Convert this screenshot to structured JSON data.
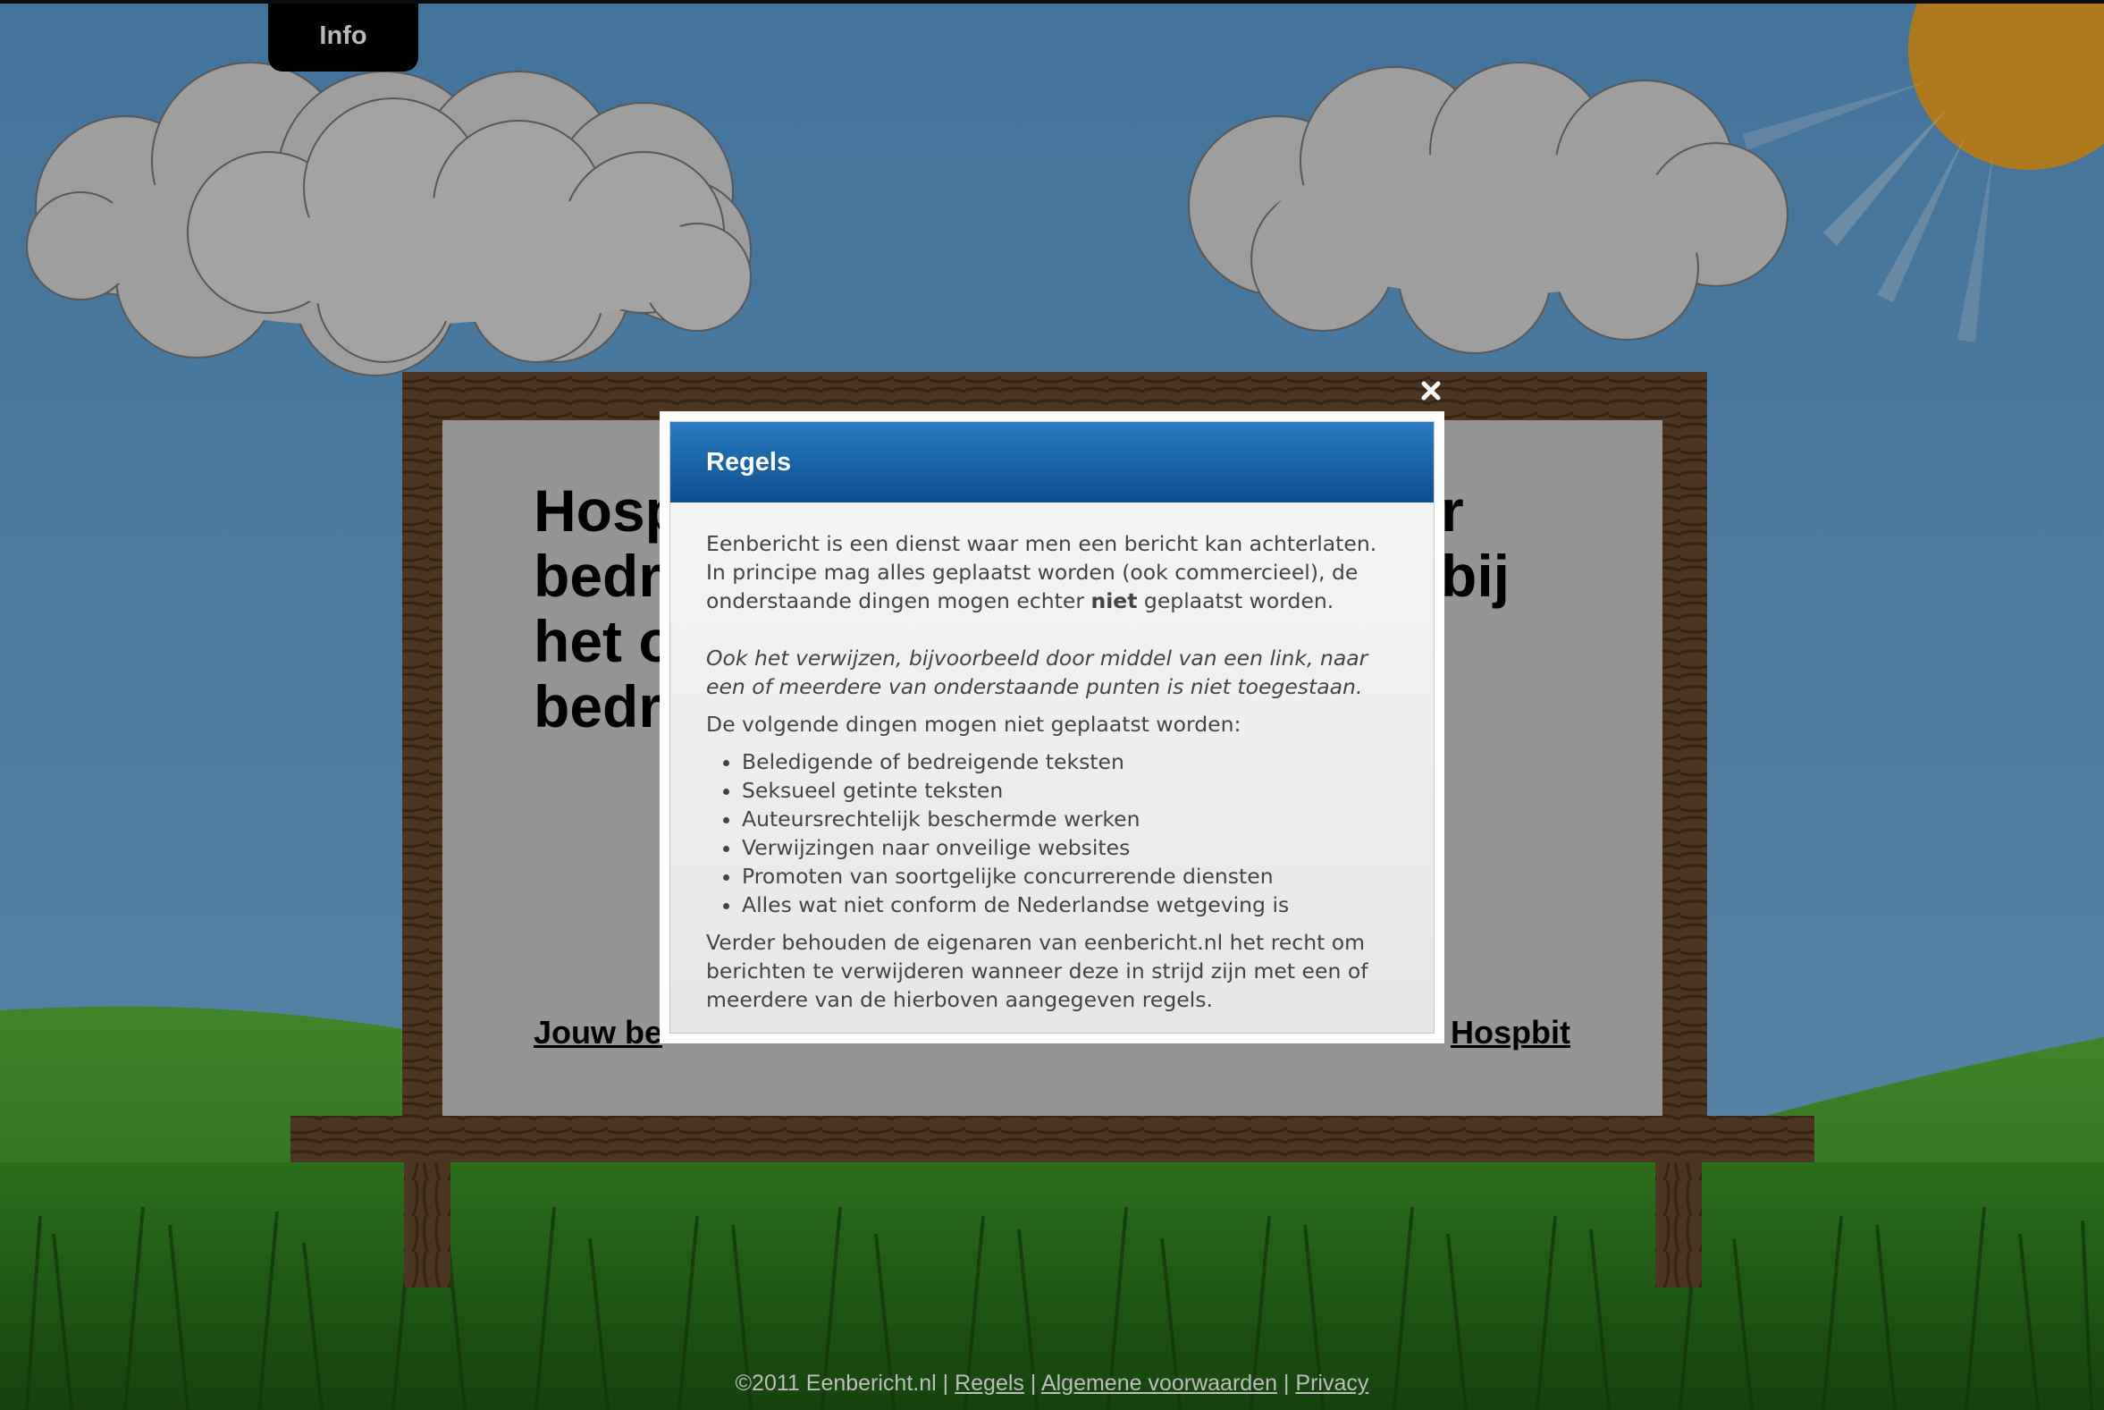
{
  "nav": {
    "info_label": "Info"
  },
  "billboard": {
    "lines": [
      "Hosp",
      "bedr",
      "het o",
      "bedr"
    ],
    "right_fragments": [
      "r",
      "bij"
    ],
    "link_left": "Jouw be",
    "link_right": "Hospbit"
  },
  "modal": {
    "title": "Regels",
    "close_label": "×",
    "intro_1": "Eenbericht is een dienst waar men een bericht kan achterlaten.",
    "intro_2": "In principe mag alles geplaatst worden (ook commercieel), de",
    "intro_3a": "onderstaande dingen mogen echter ",
    "intro_3b": "niet",
    "intro_3c": " geplaatst worden.",
    "note_1": "Ook het verwijzen, bijvoorbeeld door middel van een link, naar",
    "note_2": "een of meerdere van onderstaande punten is niet toegestaan.",
    "list_intro": "De volgende dingen mogen niet geplaatst worden:",
    "rules": [
      "Beledigende of bedreigende teksten",
      "Seksueel getinte teksten",
      "Auteursrechtelijk beschermde werken",
      "Verwijzingen naar onveilige websites",
      "Promoten van soortgelijke concurrerende diensten",
      "Alles wat niet conform de Nederlandse wetgeving is"
    ],
    "closing_1": "Verder behouden de eigenaren van eenbericht.nl het recht om",
    "closing_2": "berichten te verwijderen wanneer deze in strijd zijn met een of",
    "closing_3": "meerdere van de hierboven aangegeven regels."
  },
  "footer": {
    "copyright": "©2011 Eenbericht.nl",
    "sep": " | ",
    "links": [
      "Regels",
      "Algemene voorwaarden",
      "Privacy"
    ]
  },
  "colors": {
    "sky": "#5c9bd0",
    "sun": "#f0a828",
    "grass": "#3f9a2a",
    "wood": "#5b3e27",
    "board": "#cfcfcf",
    "modal_header": "#1a63a8"
  }
}
